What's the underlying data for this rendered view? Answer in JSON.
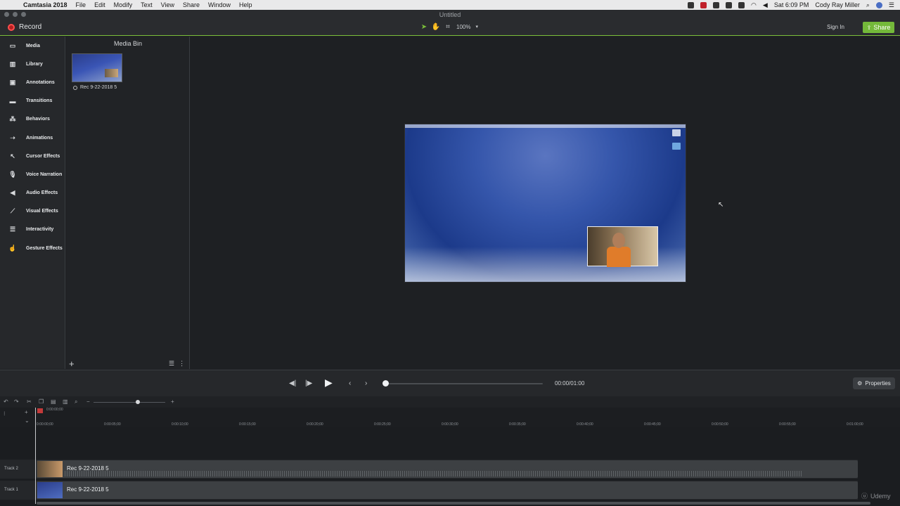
{
  "menubar": {
    "app_name": "Camtasia 2018",
    "items": [
      "File",
      "Edit",
      "Modify",
      "Text",
      "View",
      "Share",
      "Window",
      "Help"
    ],
    "clock": "Sat 6:09 PM",
    "user": "Cody Ray Miller"
  },
  "window": {
    "title": "Untitled"
  },
  "toolbar": {
    "record_label": "Record",
    "zoom": "100%",
    "signin_label": "Sign In",
    "share_label": "Share"
  },
  "sidebar": {
    "items": [
      {
        "label": "Media",
        "icon": "media-icon"
      },
      {
        "label": "Library",
        "icon": "library-icon"
      },
      {
        "label": "Annotations",
        "icon": "annotations-icon"
      },
      {
        "label": "Transitions",
        "icon": "transitions-icon"
      },
      {
        "label": "Behaviors",
        "icon": "behaviors-icon"
      },
      {
        "label": "Animations",
        "icon": "animations-icon"
      },
      {
        "label": "Cursor Effects",
        "icon": "cursor-effects-icon"
      },
      {
        "label": "Voice Narration",
        "icon": "microphone-icon"
      },
      {
        "label": "Audio Effects",
        "icon": "speaker-icon"
      },
      {
        "label": "Visual Effects",
        "icon": "wand-icon"
      },
      {
        "label": "Interactivity",
        "icon": "interactivity-icon"
      },
      {
        "label": "Gesture Effects",
        "icon": "hand-icon"
      }
    ]
  },
  "media_bin": {
    "title": "Media Bin",
    "item_label": "Rec 9-22-2018 5"
  },
  "playback": {
    "timecode": "00:00/01:00",
    "properties_label": "Properties"
  },
  "timeline": {
    "playhead_time": "0:00:00;00",
    "ticks": [
      "0:00:00;00",
      "0:00:05;00",
      "0:00:10;00",
      "0:00:15;00",
      "0:00:20;00",
      "0:00:25;00",
      "0:00:30;00",
      "0:00:35;00",
      "0:00:40;00",
      "0:00:45;00",
      "0:00:50;00",
      "0:00:55;00",
      "0:01:00;00"
    ],
    "tracks": [
      {
        "label": "Track 2",
        "clip": "Rec 9-22-2018 5"
      },
      {
        "label": "Track 1",
        "clip": "Rec 9-22-2018 5"
      }
    ]
  },
  "watermark": "Udemy",
  "colors": {
    "accent_green": "#74b93a",
    "record_red": "#ff4d4d"
  }
}
